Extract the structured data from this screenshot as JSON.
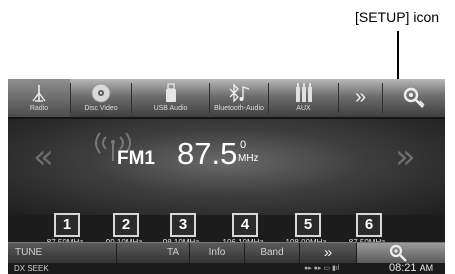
{
  "callout": {
    "label": "[SETUP] icon"
  },
  "tabs": [
    {
      "label": "Radio",
      "icon": "antenna-icon"
    },
    {
      "label": "Disc Video",
      "icon": "disc-icon"
    },
    {
      "label": "USB Audio",
      "icon": "usb-icon"
    },
    {
      "label": "Bluetooth-Audio",
      "icon": "bluetooth-audio-icon"
    },
    {
      "label": "AUX",
      "icon": "aux-icon"
    },
    {
      "label": "»",
      "icon": "double-chevron-right-icon"
    },
    {
      "label": "",
      "icon": "setup-icon"
    }
  ],
  "tuner": {
    "band": "FM1",
    "frequency_main": "87.5",
    "frequency_decimal": "0",
    "unit": "MHz",
    "prev_arrow": "«",
    "next_arrow": "»"
  },
  "presets": [
    {
      "number": "1",
      "frequency": "87.50MHz"
    },
    {
      "number": "2",
      "frequency": "90.10MHz"
    },
    {
      "number": "3",
      "frequency": "98.10MHz"
    },
    {
      "number": "4",
      "frequency": "106.10MHz"
    },
    {
      "number": "5",
      "frequency": "108.00MHz"
    },
    {
      "number": "6",
      "frequency": "87.50MHz"
    }
  ],
  "bottom_bar": {
    "tune": "TUNE",
    "ta": "TA",
    "info": "Info",
    "band": "Band",
    "more": "»"
  },
  "status_bar": {
    "seek_mode": "DX SEEK",
    "time": "08:21",
    "ampm": "AM"
  }
}
